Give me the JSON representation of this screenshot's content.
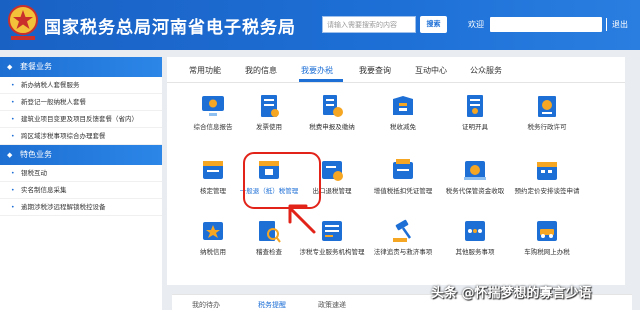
{
  "header": {
    "title": "国家税务总局河南省电子税务局",
    "search_placeholder": "请输入需要搜索的内容",
    "search_label": "搜索",
    "welcome": "欢迎",
    "logout": "退出"
  },
  "sidebar": {
    "sections": [
      {
        "title": "套餐业务",
        "items": [
          "新办纳税人套餐服务",
          "新登记一般纳税人套餐",
          "建筑业项目变更及项目反馈套餐（省内）",
          "跨区域涉税事项综合办理套餐"
        ]
      },
      {
        "title": "特色业务",
        "items": [
          "银税互动",
          "实名制信息采集",
          "逾期涉税涉远程解锁税控设备"
        ]
      }
    ]
  },
  "tabs": [
    "常用功能",
    "我的信息",
    "我要办税",
    "我要查询",
    "互动中心",
    "公众服务"
  ],
  "active_tab": "我要办税",
  "tiles": [
    {
      "label": "综合信息报告",
      "icon": "monitor-icon"
    },
    {
      "label": "发票使用",
      "icon": "invoice-icon"
    },
    {
      "label": "税费申报及缴纳",
      "icon": "tax-declare-icon"
    },
    {
      "label": "税收减免",
      "icon": "tax-reduction-icon"
    },
    {
      "label": "证明开具",
      "icon": "certificate-icon"
    },
    {
      "label": "税务行政许可",
      "icon": "admin-permit-icon"
    },
    {
      "label": "核定管理",
      "icon": "assessment-icon"
    },
    {
      "label": "一般退（抵）税管理",
      "icon": "tax-refund-icon"
    },
    {
      "label": "出口退税管理",
      "icon": "export-refund-icon"
    },
    {
      "label": "增值税抵扣凭证管理",
      "icon": "vat-voucher-icon"
    },
    {
      "label": "税务代保管资金收取",
      "icon": "fund-custody-icon"
    },
    {
      "label": "预约定价安排谈签申请",
      "icon": "calendar-icon"
    },
    {
      "label": "纳税信用",
      "icon": "credit-icon"
    },
    {
      "label": "稽查检查",
      "icon": "inspection-icon"
    },
    {
      "label": "涉税专业服务机构管理",
      "icon": "agency-icon"
    },
    {
      "label": "法律追责与救济事项",
      "icon": "gavel-icon"
    },
    {
      "label": "其他服务事项",
      "icon": "other-service-icon"
    },
    {
      "label": "车购税网上办税",
      "icon": "vehicle-tax-icon"
    }
  ],
  "bottom_tabs": [
    "我的待办",
    "税务提醒",
    "政策速递"
  ],
  "watermark": "头条 @怀揣梦想的寡言少语",
  "colors": {
    "brand": "#1d6fd6",
    "highlight": "#e2231a",
    "icon_orange": "#f5a623"
  }
}
